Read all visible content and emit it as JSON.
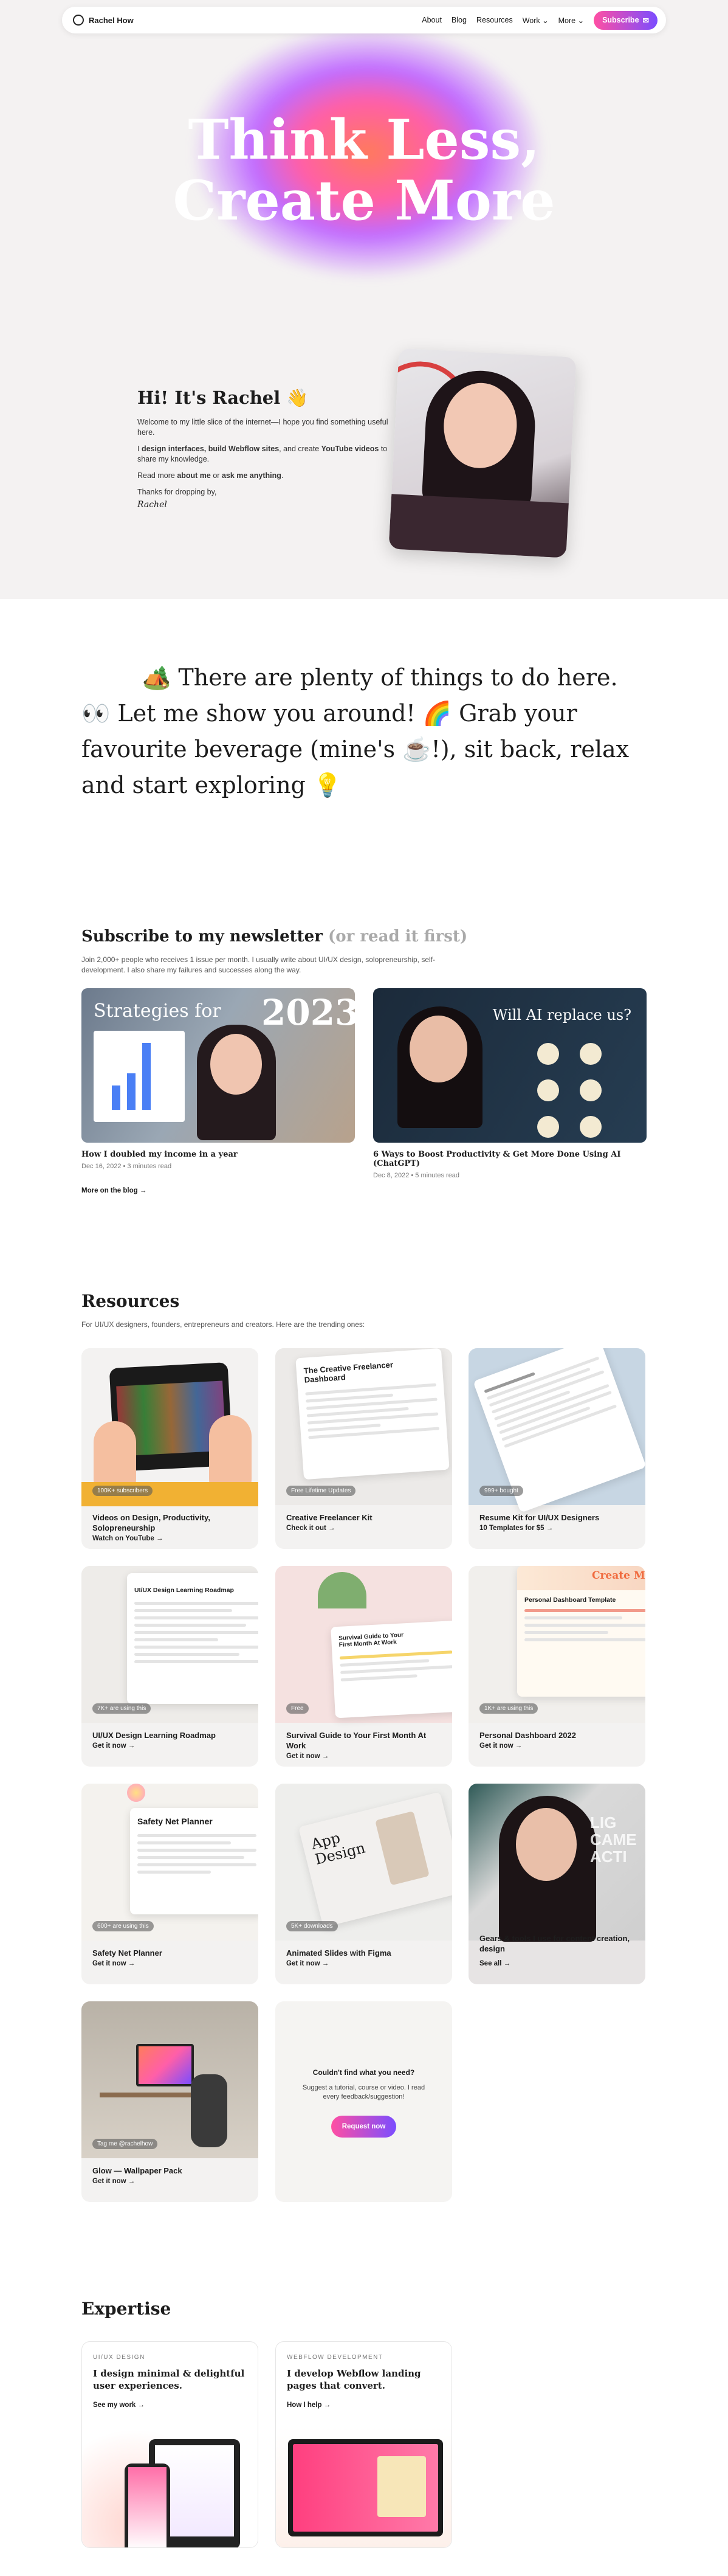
{
  "nav": {
    "brand": "Rachel How",
    "links": [
      "About",
      "Blog",
      "Resources",
      "Work",
      "More"
    ],
    "subscribe_label": "Subscribe"
  },
  "hero": {
    "title_line1": "Think Less,",
    "title_line2": "Create More"
  },
  "intro": {
    "heading": "Hi! It's Rachel 👋",
    "p1": "Welcome to my little slice of the internet—I hope you find something useful here.",
    "p2_a": "I ",
    "p2_b": "design interfaces, build Webflow sites",
    "p2_c": ", and create ",
    "p2_d": "YouTube videos",
    "p2_e": " to share my knowledge.",
    "p3_a": "Read more ",
    "p3_b": "about me",
    "p3_c": " or ",
    "p3_d": "ask me anything",
    "p3_e": ".",
    "p4": "Thanks for dropping by,",
    "signature": "Rachel"
  },
  "welcome": "🏕️ There are plenty of things to do here. 👀 Let me show you around! 🌈 Grab your favourite beverage (mine's ☕!), sit back, relax and start exploring 💡",
  "newsletter": {
    "heading": "Subscribe to my newsletter",
    "heading_muted": "(or read it first)",
    "desc": "Join 2,000+ people who receives 1 issue per month. I usually write about UI/UX design, solopreneurship, self-development. I also share my failures and successes along the way.",
    "posts": [
      {
        "title": "How I doubled my income in a year",
        "meta": "Dec 16, 2022 • 3 minutes read",
        "img_text": "Strategies for",
        "img_year": "2023"
      },
      {
        "title": "6 Ways to Boost Productivity & Get More Done Using AI (ChatGPT)",
        "meta": "Dec 8, 2022 • 5 minutes read",
        "img_text": "Will AI replace us?"
      }
    ],
    "more_label": "More on the blog →"
  },
  "resources": {
    "heading": "Resources",
    "desc": "For UI/UX designers, founders, entrepreneurs and creators. Here are the trending ones:",
    "cards": [
      {
        "tag": "100K+ subscribers",
        "title": "Videos on Design, Productivity, Solopreneurship",
        "cta": "Watch on YouTube →"
      },
      {
        "tag": "Free Lifetime Updates",
        "title": "Creative Freelancer Kit",
        "cta": "Check it out →",
        "art": "The Creative Freelancer Dashboard"
      },
      {
        "tag": "999+ bought",
        "title": "Resume Kit for UI/UX Designers",
        "cta": "10 Templates for $5 →"
      },
      {
        "tag": "7K+ are using this",
        "title": "UI/UX Design Learning Roadmap",
        "cta": "Get it now →",
        "art": "UI/UX Design Learning Roadmap"
      },
      {
        "tag": "Free",
        "title": "Survival Guide to Your First Month At Work",
        "cta": "Get it now →",
        "art": "Survival Guide to Your First Month At Work"
      },
      {
        "tag": "1K+ are using this",
        "title": "Personal Dashboard 2022",
        "cta": "Get it now →",
        "art": "Personal Dashboard Template",
        "art2": "Create Mo"
      },
      {
        "tag": "600+ are using this",
        "title": "Safety Net Planner",
        "cta": "Get it now →",
        "art": "Safety Net Planner"
      },
      {
        "tag": "5K+ downloads",
        "title": "Animated Slides with Figma",
        "cta": "Get it now →",
        "art": "App Design"
      },
      {
        "title": "Gears & tools I use for content creation, design",
        "cta": "See all →"
      },
      {
        "tag": "Tag me @rachelhow",
        "title": "Glow — Wallpaper Pack",
        "cta": "Get it now →"
      }
    ],
    "request": {
      "title": "Couldn't find what you need?",
      "text": "Suggest a tutorial, course or video. I read every feedback/suggestion!",
      "button": "Request now"
    }
  },
  "expertise": {
    "heading": "Expertise",
    "items": [
      {
        "kicker": "UI/UX DESIGN",
        "title": "I design minimal & delightful user experiences.",
        "cta": "See my work →"
      },
      {
        "kicker": "WEBFLOW DEVELOPMENT",
        "title": "I develop Webflow landing pages that convert.",
        "cta": "How I help →"
      }
    ]
  },
  "colors": {
    "accent_pink": "#ff4fa3",
    "accent_purple": "#7b4dff",
    "hero_bg": "#f4f2f2"
  }
}
